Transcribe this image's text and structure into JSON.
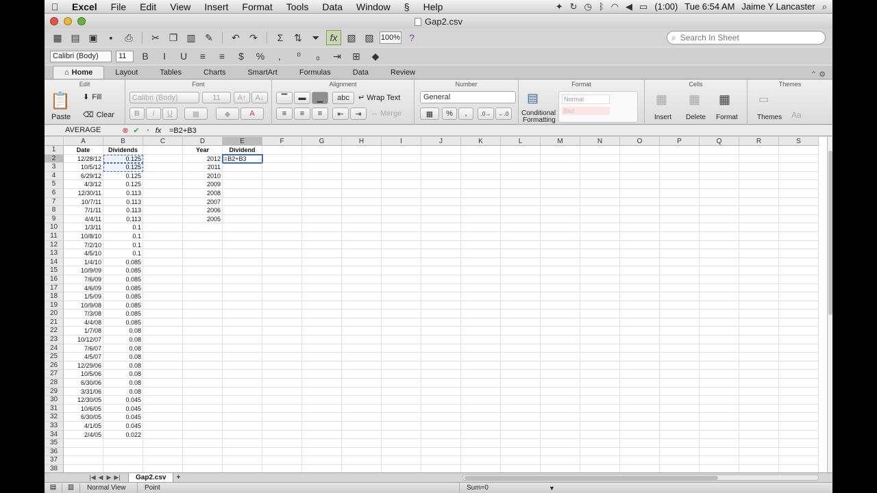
{
  "menubar": {
    "app": "Excel",
    "items": [
      "File",
      "Edit",
      "View",
      "Insert",
      "Format",
      "Tools",
      "Data",
      "Window",
      "Help"
    ],
    "battery": "(1:00)",
    "clock": "Tue 6:54 AM",
    "user": "Jaime Y Lancaster"
  },
  "window": {
    "title": "Gap2.csv"
  },
  "toolbar": {
    "zoom": "100%",
    "search_placeholder": "Search In Sheet"
  },
  "formatbar": {
    "font": "Calibri (Body)",
    "size": "11"
  },
  "tabs": [
    "Home",
    "Layout",
    "Tables",
    "Charts",
    "SmartArt",
    "Formulas",
    "Data",
    "Review"
  ],
  "ribbon": {
    "groups": {
      "edit": "Edit",
      "font": "Font",
      "alignment": "Alignment",
      "number": "Number",
      "format": "Format",
      "cells": "Cells",
      "themes": "Themes"
    },
    "paste": "Paste",
    "fill": "Fill",
    "clear": "Clear",
    "font_name": "Calibri (Body)",
    "font_size": "11",
    "wrap_text": "Wrap Text",
    "abc": "abc",
    "merge": "Merge",
    "number_format": "General",
    "conditional": "Conditional",
    "formatting": "Formatting",
    "style_normal": "Normal",
    "style_bad": "Bad",
    "insert": "Insert",
    "delete": "Delete",
    "format": "Format",
    "themes": "Themes",
    "aa": "Aa"
  },
  "formula_bar": {
    "name_box": "AVERAGE",
    "formula": "=B2+B3"
  },
  "grid": {
    "columns": [
      "A",
      "B",
      "C",
      "D",
      "E",
      "F",
      "G",
      "H",
      "I",
      "J",
      "K",
      "L",
      "M",
      "N",
      "O",
      "P",
      "Q",
      "R",
      "S"
    ],
    "selected_column": "E",
    "selected_row": 2,
    "rows": [
      [
        "Date",
        "Dividends",
        "",
        "Year",
        "Dividend"
      ],
      [
        "12/28/12",
        "0.125",
        "",
        "2012",
        "=B2+B3"
      ],
      [
        "10/5/12",
        "0.125",
        "",
        "2011",
        ""
      ],
      [
        "6/29/12",
        "0.125",
        "",
        "2010",
        ""
      ],
      [
        "4/3/12",
        "0.125",
        "",
        "2009",
        ""
      ],
      [
        "12/30/11",
        "0.113",
        "",
        "2008",
        ""
      ],
      [
        "10/7/11",
        "0.113",
        "",
        "2007",
        ""
      ],
      [
        "7/1/11",
        "0.113",
        "",
        "2006",
        ""
      ],
      [
        "4/4/11",
        "0.113",
        "",
        "2005",
        ""
      ],
      [
        "1/3/11",
        "0.1",
        "",
        "",
        ""
      ],
      [
        "10/8/10",
        "0.1",
        "",
        "",
        ""
      ],
      [
        "7/2/10",
        "0.1",
        "",
        "",
        ""
      ],
      [
        "4/5/10",
        "0.1",
        "",
        "",
        ""
      ],
      [
        "1/4/10",
        "0.085",
        "",
        "",
        ""
      ],
      [
        "10/9/09",
        "0.085",
        "",
        "",
        ""
      ],
      [
        "7/6/09",
        "0.085",
        "",
        "",
        ""
      ],
      [
        "4/6/09",
        "0.085",
        "",
        "",
        ""
      ],
      [
        "1/5/09",
        "0.085",
        "",
        "",
        ""
      ],
      [
        "10/9/08",
        "0.085",
        "",
        "",
        ""
      ],
      [
        "7/3/08",
        "0.085",
        "",
        "",
        ""
      ],
      [
        "4/4/08",
        "0.085",
        "",
        "",
        ""
      ],
      [
        "1/7/08",
        "0.08",
        "",
        "",
        ""
      ],
      [
        "10/12/07",
        "0.08",
        "",
        "",
        ""
      ],
      [
        "7/6/07",
        "0.08",
        "",
        "",
        ""
      ],
      [
        "4/5/07",
        "0.08",
        "",
        "",
        ""
      ],
      [
        "12/29/06",
        "0.08",
        "",
        "",
        ""
      ],
      [
        "10/5/06",
        "0.08",
        "",
        "",
        ""
      ],
      [
        "6/30/06",
        "0.08",
        "",
        "",
        ""
      ],
      [
        "3/31/06",
        "0.08",
        "",
        "",
        ""
      ],
      [
        "12/30/05",
        "0.045",
        "",
        "",
        ""
      ],
      [
        "10/6/05",
        "0.045",
        "",
        "",
        ""
      ],
      [
        "6/30/05",
        "0.045",
        "",
        "",
        ""
      ],
      [
        "4/1/05",
        "0.045",
        "",
        "",
        ""
      ],
      [
        "2/4/05",
        "0.022",
        "",
        "",
        ""
      ],
      [
        "",
        "",
        "",
        "",
        ""
      ],
      [
        "",
        "",
        "",
        "",
        ""
      ],
      [
        "",
        "",
        "",
        "",
        ""
      ],
      [
        "",
        "",
        "",
        "",
        ""
      ]
    ]
  },
  "sheet_tab": "Gap2.csv",
  "status": {
    "view": "Normal View",
    "mode": "Point",
    "sum": "Sum=0"
  }
}
